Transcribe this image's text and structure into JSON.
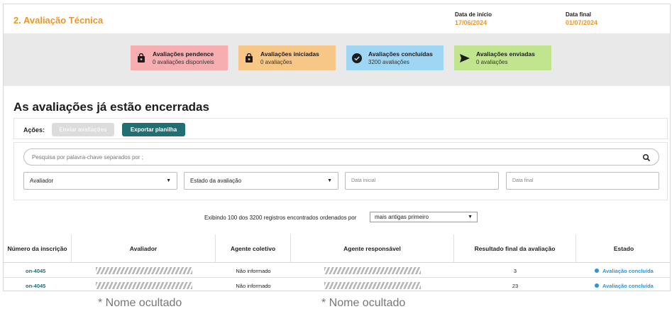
{
  "header": {
    "section_title": "2. Avaliação Técnica",
    "start_label": "Data de início",
    "start_value": "17/06/2024",
    "end_label": "Data final",
    "end_value": "01/07/2024"
  },
  "status_cards": [
    {
      "title": "Avaliações pendence",
      "subtitle": "0 avaliações disponíveis",
      "color": "#f6aeb1",
      "icon": "lock-bag-icon"
    },
    {
      "title": "Avaliações iniciadas",
      "subtitle": "0 avaliações",
      "color": "#f7c788",
      "icon": "lock-bag-icon"
    },
    {
      "title": "Avaliações concluídas",
      "subtitle": "3200 avaliações",
      "color": "#9fd6f4",
      "icon": "check-circle-icon"
    },
    {
      "title": "Avaliações enviadas",
      "subtitle": "0 avaliações",
      "color": "#c1e58e",
      "icon": "send-arrow-icon"
    }
  ],
  "main": {
    "title": "As avaliações já estão encerradas"
  },
  "actions": {
    "label": "Ações:",
    "send_button": "Enviar avaliações",
    "export_button": "Exportar planilha"
  },
  "filters": {
    "search_placeholder": "Pesquisa por palavra-chave separados por ;",
    "evaluator": "Avaliador",
    "evaluation_state": "Estado da avaliação",
    "start_date_placeholder": "Data inicial",
    "end_date_placeholder": "Data final"
  },
  "records": {
    "summary": "Exibindo 100 dos 3200 registros encontrados ordenados por",
    "sort_value": "mais antigas primeiro"
  },
  "table": {
    "headers": [
      "Número da inscrição",
      "Avaliador",
      "Agente coletivo",
      "Agente responsável",
      "Resultado final da avaliação",
      "Estado"
    ],
    "rows": [
      {
        "id": "on-4045",
        "collective": "Não informado",
        "result": "3",
        "state": "Avaliação concluída"
      },
      {
        "id": "on-4045",
        "collective": "Não informado",
        "result": "23",
        "state": "Avaliação concluída"
      }
    ]
  },
  "notes": {
    "hidden_name_1": "* Nome ocultado",
    "hidden_name_2": "* Nome ocultado"
  },
  "colors": {
    "accent_orange": "#e8962e",
    "primary_teal": "#1f6f73",
    "state_blue": "#2b95d8"
  }
}
